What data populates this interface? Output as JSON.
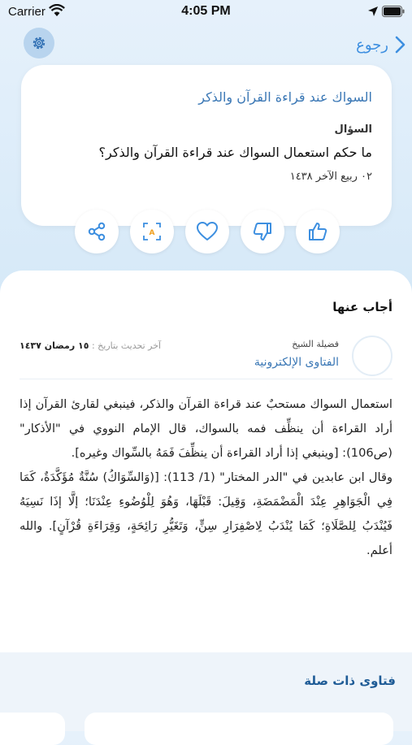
{
  "status_bar": {
    "carrier": "Carrier",
    "time": "4:05 PM"
  },
  "nav": {
    "back_label": "رجوع"
  },
  "question": {
    "title": "السواك عند قراءة القرآن والذكر",
    "label": "السؤال",
    "text": "ما حكم استعمال السواك عند قراءة القرآن والذكر؟",
    "date": "٠٢ ربيع الآخر ١٤٣٨"
  },
  "actions": [
    "share-icon",
    "translate-icon",
    "heart-icon",
    "thumbs-down-icon",
    "thumbs-up-icon"
  ],
  "answer": {
    "heading": "أجاب عنها",
    "scholar_label": "فضيلة الشيخ",
    "scholar_name": "الفتاوى الإلكترونية",
    "updated_label": "آخر تحديث بتاريخ :",
    "updated_date": "١٥ رمضان ١٤٣٧",
    "paragraph1": "استعمال السواك مستحبٌ عند قراءة القرآن والذكر، فينبغي لقارئ القرآن إذا أراد القراءة أن ينظِّف فمه بالسواك، قال الإمام النووي في \"الأذكار\" (ص106): [وينبغي إذا أراد القراءة أن ينظِّفَ فَمَهُ بالسِّواك وغيره].",
    "paragraph2": "وقال ابن عابدين في \"الدر المختار\" (1/ 113): [(وَالسِّوَاكُ) سُنَّةٌ مُؤَكَّدَةٌ، كَمَا فِي الْجَوَاهِرِ عِنْدَ الْمَضْمَضَةِ، وَقِيلَ: قَبْلَهَا، وَهُوَ لِلْوُضُوءِ عِنْدَنَا؛ إلَّا إذَا نَسِيَهُ فَيُنْدَبُ لِلصَّلَاةِ؛ كَمَا يُنْدَبُ لِاصْفِرَارِ سِنٍّ، وَتَغَيُّرِ رَائِحَةٍ، وَقِرَاءَةِ قُرْآنٍ]. والله أعلم."
  },
  "related": {
    "title": "فتاوى ذات صلة"
  },
  "colors": {
    "accent": "#3d8fe0",
    "link": "#3a77b5",
    "heading": "#1e5b96"
  }
}
